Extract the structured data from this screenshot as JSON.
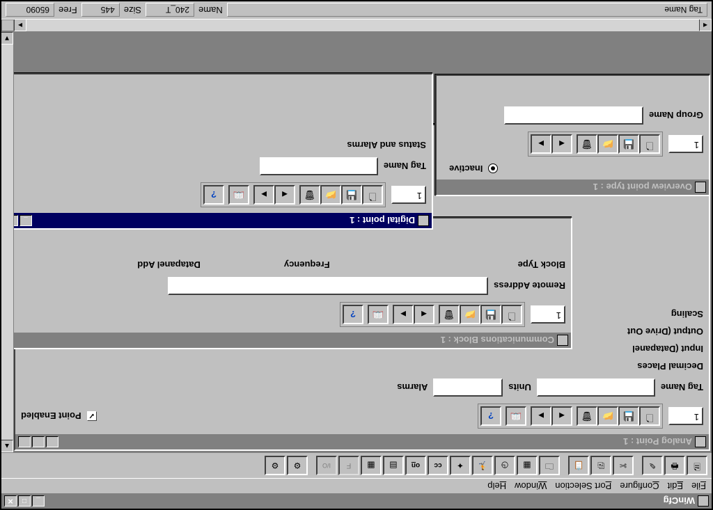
{
  "app": {
    "title": "WinCfg"
  },
  "menubar": [
    "File",
    "Edit",
    "Configure",
    "Port Selection",
    "Window",
    "Help"
  ],
  "main_toolbar": {
    "icons": [
      "doc-icon",
      "print-icon",
      "edit-icon",
      "cut-icon",
      "copy-icon",
      "paste-icon",
      "folder-icon",
      "db-icon",
      "clock-icon",
      "runner-icon",
      "wizard-icon",
      "cc",
      "on",
      "grid-icon",
      "grid2-icon",
      "F",
      "I/O",
      "config-icon",
      "config2-icon"
    ]
  },
  "windows": {
    "analog": {
      "title": "Analog Point : 1",
      "id_value": "1",
      "tag_name_label": "Tag Name",
      "tag_name_value": "",
      "units_label": "Units",
      "units_value": "",
      "alarms_label": "Alarms",
      "decimal_places_label": "Decimal Places",
      "input_label": "Input (Datapanel",
      "output_label": "Output (Drive Out",
      "scaling_label": "Scaling",
      "point_enabled_label": "Point Enabled",
      "point_enabled_checked": true
    },
    "comm": {
      "title": "Communications Block : 1",
      "id_value": "1",
      "remote_address_label": "Remote Address",
      "remote_address_value": "",
      "block_type_label": "Block Type",
      "frequency_label": "Frequency",
      "datapanel_add_label": "Datapanel Add"
    },
    "overview": {
      "title": "Overview point type : 1",
      "id_value": "1",
      "inactive_label": "Inactive",
      "group_name_label": "Group Name",
      "group_name_value": ""
    },
    "digital": {
      "title": "Digital point : 1",
      "id_value": "1",
      "tag_name_label": "Tag Name",
      "tag_name_value": "",
      "status_alarms_label": "Status and Alarms"
    }
  },
  "statusbar": {
    "tag_name_label": "Tag Name",
    "name_label": "Name",
    "name_value": "240_T",
    "size_label": "Size",
    "size_value": "445",
    "free_label": "Free",
    "free_value": "65090"
  }
}
